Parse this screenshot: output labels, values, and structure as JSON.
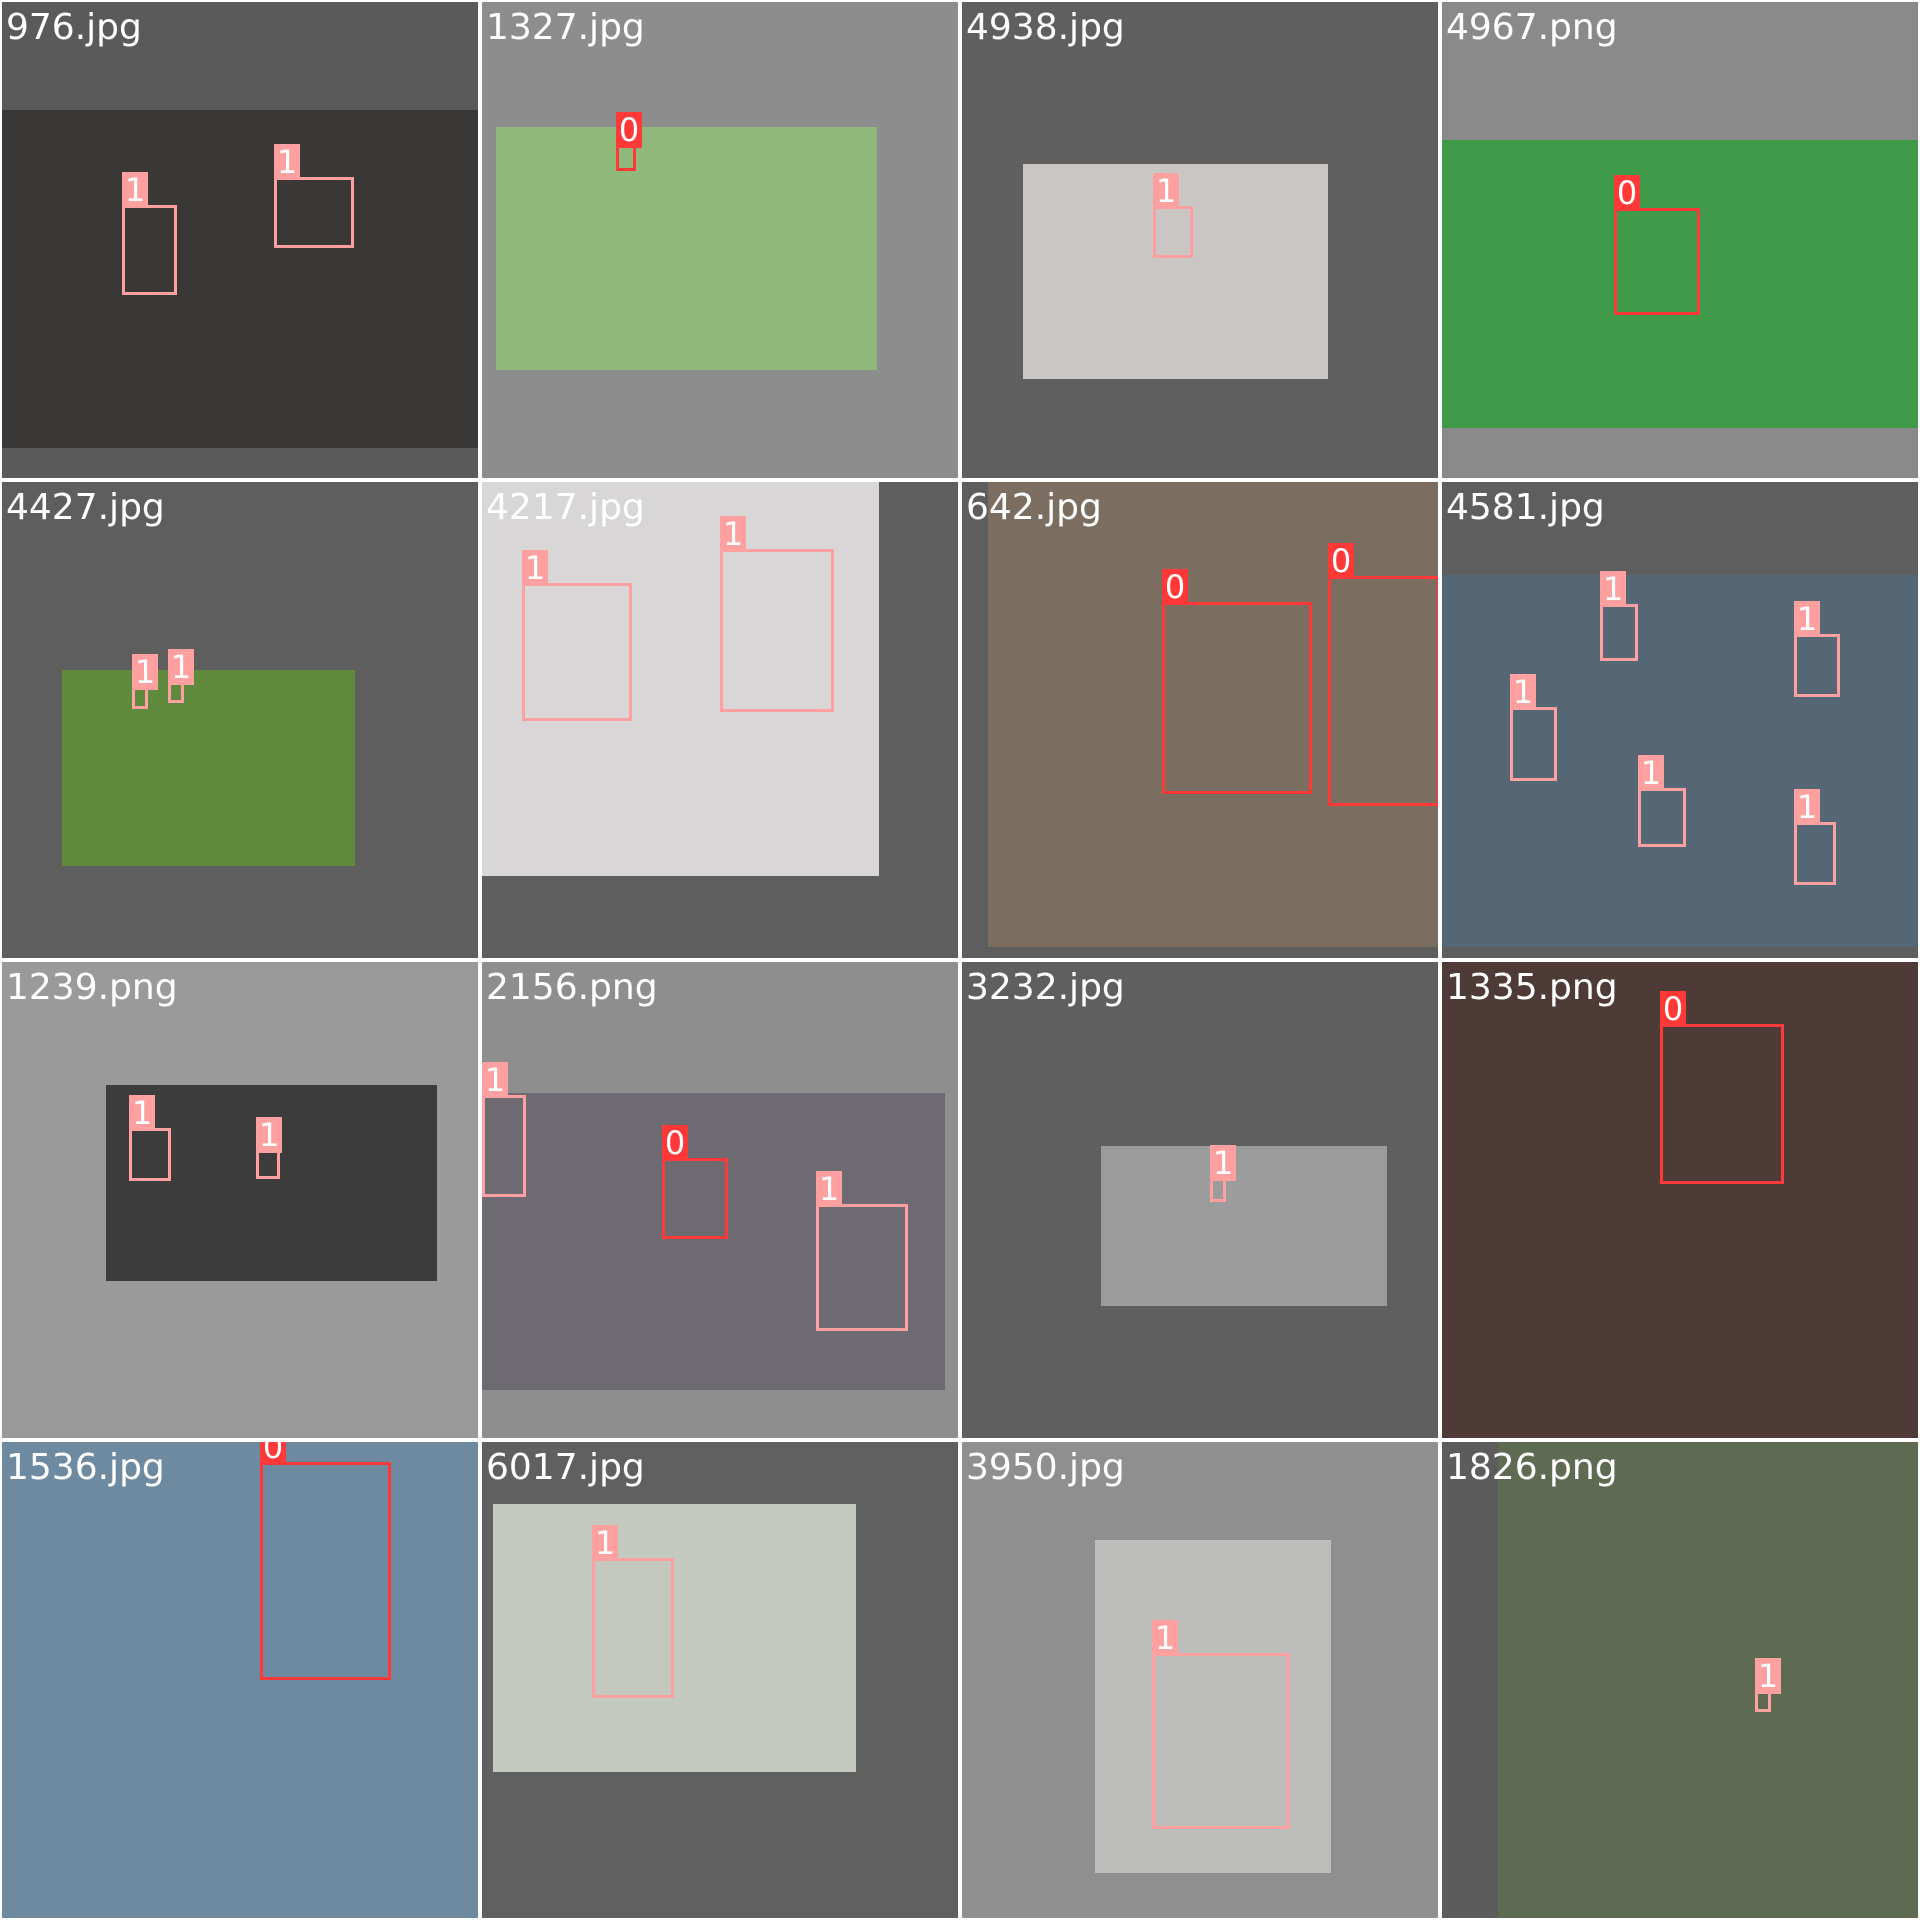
{
  "colors": {
    "class_0": "#ff3838",
    "class_1": "#ffa0a0",
    "filename_text": "#ffffff",
    "tile_dark": "#5f5f5f",
    "tile_light": "#8f8f8f",
    "tile_lighter": "#9a9a9a"
  },
  "tiles": [
    {
      "file": "976.jpg",
      "bg": "#5a5a5a",
      "photo": "#3a3836",
      "boxes": [
        {
          "label": "1",
          "cls": 1
        },
        {
          "label": "1",
          "cls": 1
        }
      ]
    },
    {
      "file": "1327.jpg",
      "bg": "#8d8d8d",
      "photo": "#8fb87a",
      "boxes": [
        {
          "label": "0",
          "cls": 0
        }
      ]
    },
    {
      "file": "4938.jpg",
      "bg": "#5f5f5f",
      "photo": "#c9c6c3",
      "boxes": [
        {
          "label": "1",
          "cls": 1
        }
      ]
    },
    {
      "file": "4967.png",
      "bg": "#8a8a8a",
      "photo": "#3f9a4a",
      "boxes": [
        {
          "label": "0",
          "cls": 0
        }
      ]
    },
    {
      "file": "4427.jpg",
      "bg": "#5e5e5e",
      "photo": "#5f8a3e",
      "boxes": [
        {
          "label": "1",
          "cls": 1
        },
        {
          "label": "1",
          "cls": 1
        }
      ]
    },
    {
      "file": "4217.jpg",
      "bg": "#5e5e5e",
      "photo": "#d8d6d6",
      "boxes": [
        {
          "label": "1",
          "cls": 1
        },
        {
          "label": "1",
          "cls": 1
        }
      ]
    },
    {
      "file": "642.jpg",
      "bg": "#5e5e5e",
      "photo": "#7b6d60",
      "boxes": [
        {
          "label": "0",
          "cls": 0
        },
        {
          "label": "0",
          "cls": 0
        }
      ]
    },
    {
      "file": "4581.jpg",
      "bg": "#5e5e5e",
      "photo": "#556675",
      "boxes": [
        {
          "label": "1",
          "cls": 1
        },
        {
          "label": "1",
          "cls": 1
        },
        {
          "label": "1",
          "cls": 1
        },
        {
          "label": "1",
          "cls": 1
        },
        {
          "label": "1",
          "cls": 1
        }
      ]
    },
    {
      "file": "1239.png",
      "bg": "#9a9a9a",
      "photo": "#3c3c3c",
      "boxes": [
        {
          "label": "1",
          "cls": 1
        },
        {
          "label": "1",
          "cls": 1
        }
      ]
    },
    {
      "file": "2156.png",
      "bg": "#8e8e8e",
      "photo": "#6e6a72",
      "boxes": [
        {
          "label": "1",
          "cls": 1
        },
        {
          "label": "0",
          "cls": 0
        },
        {
          "label": "1",
          "cls": 1
        }
      ]
    },
    {
      "file": "3232.jpg",
      "bg": "#5f5f5f",
      "photo": "#9c9c9c",
      "boxes": [
        {
          "label": "1",
          "cls": 1
        }
      ]
    },
    {
      "file": "1335.png",
      "bg": "#5e5e5e",
      "photo": "#4e3a36",
      "boxes": [
        {
          "label": "0",
          "cls": 0
        }
      ]
    },
    {
      "file": "1536.jpg",
      "bg": "#9aa6b1",
      "photo": "#6e8aa0",
      "boxes": [
        {
          "label": "0",
          "cls": 0
        }
      ]
    },
    {
      "file": "6017.jpg",
      "bg": "#606060",
      "photo": "#c4c9c0",
      "boxes": [
        {
          "label": "1",
          "cls": 1
        }
      ]
    },
    {
      "file": "3950.jpg",
      "bg": "#8f8f8f",
      "photo": "#bdbdbb",
      "boxes": [
        {
          "label": "1",
          "cls": 1
        }
      ]
    },
    {
      "file": "1826.png",
      "bg": "#5c5c5c",
      "photo": "#5f6a52",
      "boxes": [
        {
          "label": "1",
          "cls": 1
        }
      ]
    }
  ]
}
